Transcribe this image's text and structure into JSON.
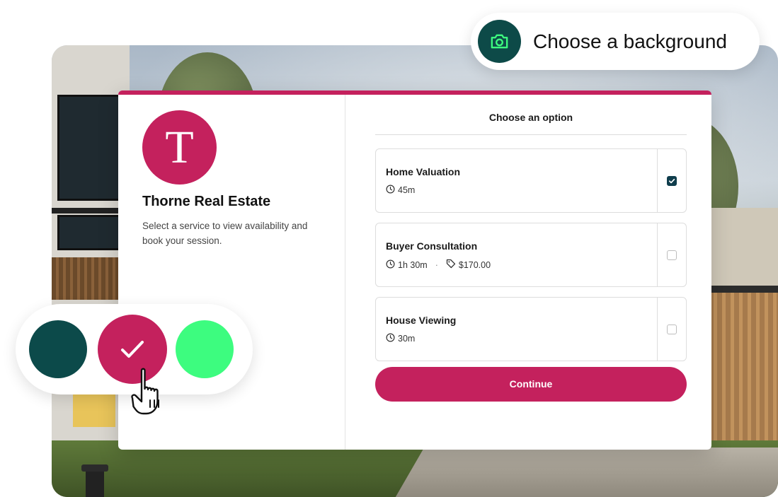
{
  "background_chip": {
    "label": "Choose a background",
    "icon": "camera-icon"
  },
  "card": {
    "company": {
      "logo_letter": "T",
      "name": "Thorne Real Estate",
      "description": "Select a service to view availability and book your session."
    },
    "options": {
      "title": "Choose an option",
      "services": [
        {
          "name": "Home Valuation",
          "duration": "45m",
          "price": "",
          "selected": true
        },
        {
          "name": "Buyer Consultation",
          "duration": "1h 30m",
          "separator": "·",
          "price": "$170.00",
          "selected": false
        },
        {
          "name": "House Viewing",
          "duration": "30m",
          "price": "",
          "selected": false
        }
      ],
      "continue_label": "Continue"
    }
  },
  "swatches": {
    "colors": [
      "#0c4a4a",
      "#c4215d",
      "#3dfc7f"
    ],
    "selected_index": 1
  },
  "colors": {
    "brand": "#c4215d",
    "checkbox_checked": "#0f3d4c",
    "camera_bg": "#0d4a48"
  }
}
